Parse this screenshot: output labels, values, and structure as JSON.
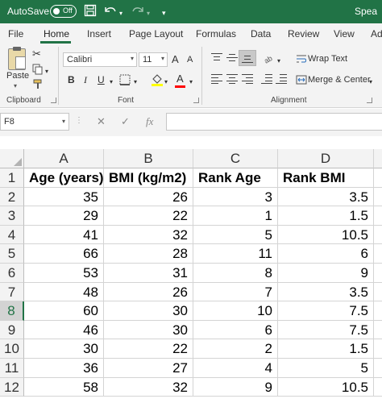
{
  "titlebar": {
    "autosave_label": "AutoSave",
    "toggle_state": "Off",
    "filename": "Spea"
  },
  "tabs": [
    {
      "label": "File"
    },
    {
      "label": "Home"
    },
    {
      "label": "Insert"
    },
    {
      "label": "Page Layout"
    },
    {
      "label": "Formulas"
    },
    {
      "label": "Data"
    },
    {
      "label": "Review"
    },
    {
      "label": "View"
    },
    {
      "label": "Ad"
    }
  ],
  "ribbon": {
    "clipboard": {
      "paste_label": "Paste",
      "group_label": "Clipboard"
    },
    "font": {
      "font_name": "Calibri",
      "font_size": "11",
      "group_label": "Font",
      "grow": "A",
      "shrink": "A",
      "bold": "B",
      "italic": "I",
      "underline": "U",
      "font_color_letter": "A"
    },
    "alignment": {
      "wrap_text": "Wrap Text",
      "merge_center": "Merge & Center",
      "group_label": "Alignment"
    }
  },
  "formula_bar": {
    "name_box": "F8",
    "formula": ""
  },
  "sheet": {
    "columns": [
      "A",
      "B",
      "C",
      "D"
    ],
    "row_numbers": [
      "1",
      "2",
      "3",
      "4",
      "5",
      "6",
      "7",
      "8",
      "9",
      "10",
      "11",
      "12"
    ],
    "selected_row": "8",
    "rows": [
      [
        "Age (years)",
        "BMI (kg/m2)",
        "Rank Age",
        "Rank BMI"
      ],
      [
        "35",
        "26",
        "3",
        "3.5"
      ],
      [
        "29",
        "22",
        "1",
        "1.5"
      ],
      [
        "41",
        "32",
        "5",
        "10.5"
      ],
      [
        "66",
        "28",
        "11",
        "6"
      ],
      [
        "53",
        "31",
        "8",
        "9"
      ],
      [
        "48",
        "26",
        "7",
        "3.5"
      ],
      [
        "60",
        "30",
        "10",
        "7.5"
      ],
      [
        "46",
        "30",
        "6",
        "7.5"
      ],
      [
        "30",
        "22",
        "2",
        "1.5"
      ],
      [
        "36",
        "27",
        "4",
        "5"
      ],
      [
        "58",
        "32",
        "9",
        "10.5"
      ]
    ]
  },
  "colors": {
    "accent": "#217346",
    "ribbon_bg": "#f3f3f3",
    "fill_yellow": "#ffff00",
    "font_red": "#ff0000"
  }
}
